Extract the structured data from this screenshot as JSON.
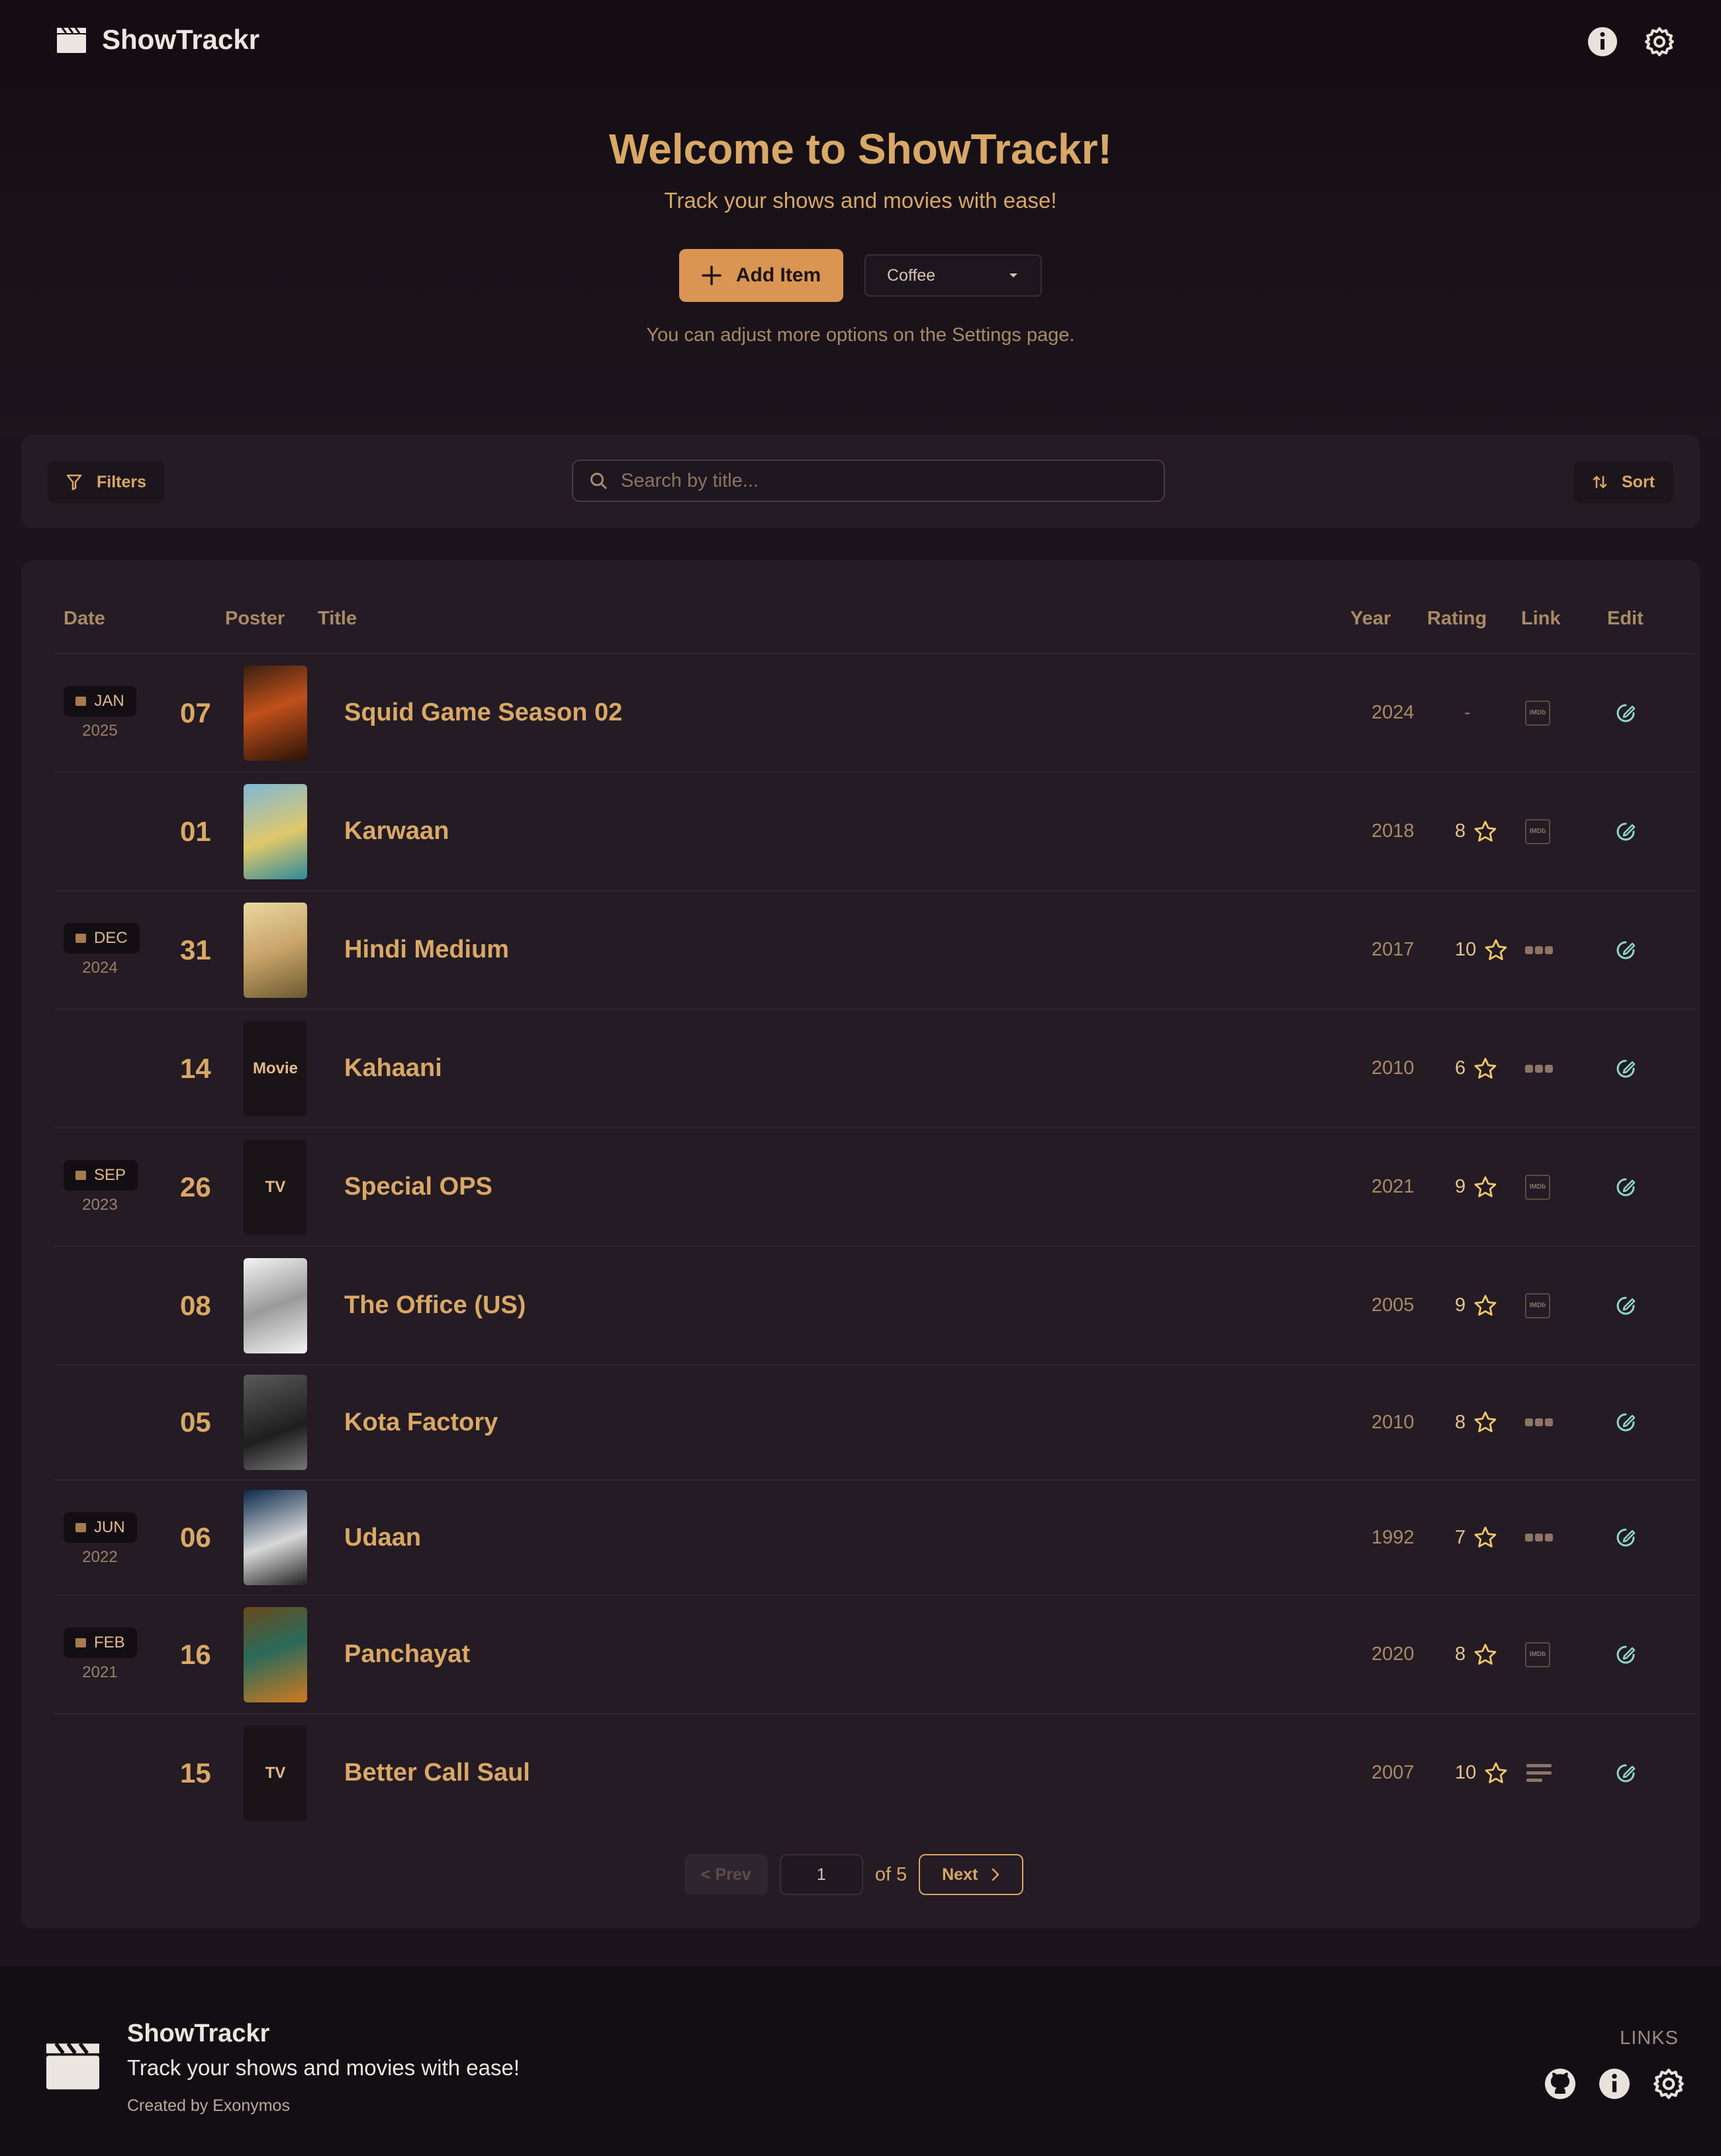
{
  "app": {
    "name": "ShowTrackr"
  },
  "hero": {
    "title": "Welcome to ShowTrackr!",
    "subtitle": "Track your shows and movies with ease!",
    "add_button": "Add Item",
    "theme_select": "Coffee",
    "note": "You can adjust more options on the Settings page."
  },
  "toolbar": {
    "filters_label": "Filters",
    "search_placeholder": "Search by title...",
    "sort_label": "Sort"
  },
  "table": {
    "headers": {
      "date": "Date",
      "poster": "Poster",
      "title": "Title",
      "year": "Year",
      "rating": "Rating",
      "link": "Link",
      "edit": "Edit"
    },
    "rows": [
      {
        "month": "JAN",
        "date_year": "2025",
        "day": "07",
        "title": "Squid Game Season 02",
        "year": "2024",
        "rating": "-",
        "link": "imdb",
        "poster": "image"
      },
      {
        "month": "",
        "date_year": "",
        "day": "01",
        "title": "Karwaan",
        "year": "2018",
        "rating": "8",
        "link": "imdb",
        "poster": "image"
      },
      {
        "month": "DEC",
        "date_year": "2024",
        "day": "31",
        "title": "Hindi Medium",
        "year": "2017",
        "rating": "10",
        "link": "letterboxd",
        "poster": "image"
      },
      {
        "month": "",
        "date_year": "",
        "day": "14",
        "title": "Kahaani",
        "year": "2010",
        "rating": "6",
        "link": "letterboxd",
        "poster": "Movie"
      },
      {
        "month": "SEP",
        "date_year": "2023",
        "day": "26",
        "title": "Special OPS",
        "year": "2021",
        "rating": "9",
        "link": "imdb",
        "poster": "TV"
      },
      {
        "month": "",
        "date_year": "",
        "day": "08",
        "title": "The Office (US)",
        "year": "2005",
        "rating": "9",
        "link": "imdb",
        "poster": "image"
      },
      {
        "month": "",
        "date_year": "",
        "day": "05",
        "title": "Kota Factory",
        "year": "2010",
        "rating": "8",
        "link": "letterboxd",
        "poster": "image"
      },
      {
        "month": "JUN",
        "date_year": "2022",
        "day": "06",
        "title": "Udaan",
        "year": "1992",
        "rating": "7",
        "link": "letterboxd",
        "poster": "image"
      },
      {
        "month": "FEB",
        "date_year": "2021",
        "day": "16",
        "title": "Panchayat",
        "year": "2020",
        "rating": "8",
        "link": "imdb",
        "poster": "image"
      },
      {
        "month": "",
        "date_year": "",
        "day": "15",
        "title": "Better Call Saul",
        "year": "2007",
        "rating": "10",
        "link": "tmdb",
        "poster": "TV"
      }
    ]
  },
  "pagination": {
    "prev": "< Prev",
    "page": "1",
    "of": "of 5",
    "next": "Next"
  },
  "footer": {
    "name": "ShowTrackr",
    "tagline": "Track your shows and movies with ease!",
    "credit": "Created by Exonymos",
    "links_heading": "LINKS"
  },
  "colors": {
    "accent": "#d9a865",
    "button": "#db9552",
    "background": "#1c141c",
    "edit_icon": "#8fd6c8"
  },
  "icons": [
    "clapperboard-icon",
    "info-icon",
    "gear-icon",
    "plus-icon",
    "caret-down-icon",
    "filter-icon",
    "search-icon",
    "sort-icon",
    "star-icon",
    "edit-icon",
    "github-icon",
    "chevron-right-icon"
  ]
}
